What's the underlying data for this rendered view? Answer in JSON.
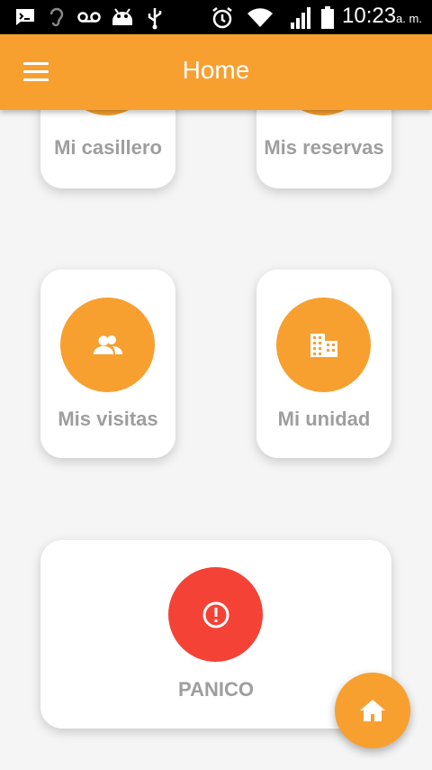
{
  "status_bar": {
    "time": "10:23",
    "ampm": "a. m.",
    "icons": [
      "message-icon",
      "hearing-icon",
      "voicemail-icon",
      "android-icon",
      "usb-icon",
      "alarm-icon",
      "wifi-icon",
      "signal-icon",
      "battery-icon"
    ]
  },
  "app_bar": {
    "title": "Home",
    "menu_icon": "menu-icon"
  },
  "cards": [
    {
      "label": "Mi casillero",
      "icon": "locker-icon"
    },
    {
      "label": "Mis reservas",
      "icon": "calendar-icon"
    },
    {
      "label": "Mis visitas",
      "icon": "people-icon"
    },
    {
      "label": "Mi unidad",
      "icon": "building-icon"
    },
    {
      "label": "PANICO",
      "icon": "alert-icon"
    }
  ],
  "fab": {
    "icon": "home-icon"
  },
  "colors": {
    "accent": "#f7a030",
    "panic": "#f44336",
    "label": "#9e9e9e",
    "background": "#f5f5f5"
  }
}
